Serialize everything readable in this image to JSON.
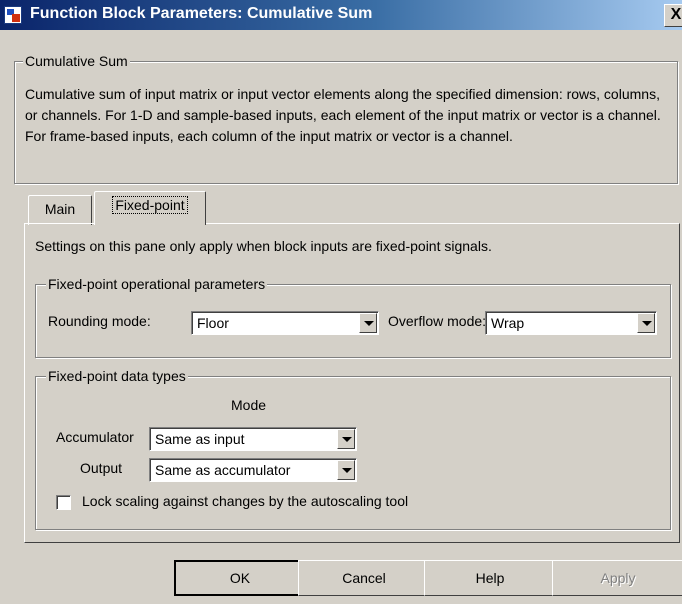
{
  "window": {
    "title": "Function Block Parameters: Cumulative Sum",
    "close_glyph": "X",
    "icon": "simulink-block-icon"
  },
  "description_group": {
    "legend": "Cumulative Sum",
    "text": "Cumulative sum of input matrix or input vector elements along the specified dimension: rows, columns, or channels.  For 1-D and sample-based inputs, each element of the input matrix or vector is a channel.  For frame-based inputs, each column of the input matrix or vector is a channel."
  },
  "tabs": [
    {
      "label": "Main",
      "active": false
    },
    {
      "label": "Fixed-point",
      "active": true
    }
  ],
  "panel": {
    "info_text": "Settings on this pane only apply when block inputs are fixed-point signals.",
    "op_params": {
      "legend": "Fixed-point operational parameters",
      "rounding_label": "Rounding mode:",
      "rounding_value": "Floor",
      "overflow_label": "Overflow mode:",
      "overflow_value": "Wrap"
    },
    "data_types": {
      "legend": "Fixed-point data types",
      "mode_header": "Mode",
      "accumulator_label": "Accumulator",
      "accumulator_value": "Same as input",
      "output_label": "Output",
      "output_value": "Same as accumulator",
      "lock_scaling_label": "Lock scaling against changes by the autoscaling tool",
      "lock_scaling_checked": false
    }
  },
  "buttons": {
    "ok": "OK",
    "cancel": "Cancel",
    "help": "Help",
    "apply": "Apply"
  }
}
